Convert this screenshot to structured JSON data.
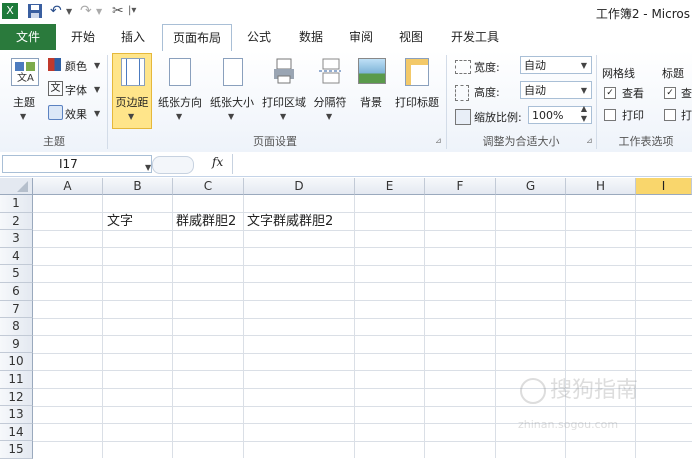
{
  "window": {
    "title": "工作簿2 - Micros"
  },
  "tabs": [
    "文件",
    "开始",
    "插入",
    "页面布局",
    "公式",
    "数据",
    "审阅",
    "视图",
    "开发工具"
  ],
  "ribbon": {
    "theme_group": {
      "theme_label": "主题",
      "colors_label": "颜色",
      "fonts_label": "字体",
      "effects_label": "效果",
      "group_label": "主题"
    },
    "page_setup": {
      "margins": "页边距",
      "orientation": "纸张方向",
      "size": "纸张大小",
      "print_area": "打印区域",
      "breaks": "分隔符",
      "background": "背景",
      "print_titles": "打印标题",
      "group_label": "页面设置"
    },
    "scale": {
      "width_label": "宽度:",
      "width_value": "自动",
      "height_label": "高度:",
      "height_value": "自动",
      "scale_label": "缩放比例:",
      "scale_value": "100%",
      "group_label": "调整为合适大小"
    },
    "sheet_options": {
      "gridlines": "网格线",
      "headings": "标题",
      "view": "查看",
      "view2": "查",
      "print": "打印",
      "print2": "打",
      "group_label": "工作表选项"
    }
  },
  "formula_bar": {
    "name_box": "I17",
    "fx": "fx",
    "formula": ""
  },
  "grid": {
    "columns": [
      "A",
      "B",
      "C",
      "D",
      "E",
      "F",
      "G",
      "H",
      "I"
    ],
    "rows": [
      "1",
      "2",
      "3",
      "4",
      "5",
      "6",
      "7",
      "8",
      "9",
      "10",
      "11",
      "12",
      "13",
      "14",
      "15"
    ],
    "cells": {
      "B2": "文字",
      "C2": "群威群胆2",
      "D2": "文字群威群胆2"
    }
  },
  "watermark": {
    "main": "搜狗指南",
    "sub": "zhinan.sogou.com"
  },
  "colors": {
    "file_tab": "#2a7a3c",
    "selected_header": "#f9d66c",
    "highlight": "#ffe58a"
  }
}
